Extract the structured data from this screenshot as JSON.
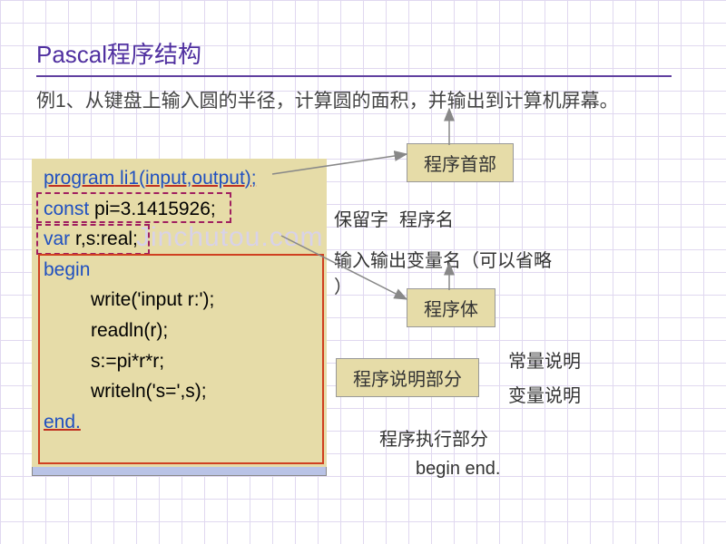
{
  "title": "Pascal程序结构",
  "example": "例1、从键盘上输入圆的半径，计算圆的面积，并输出到计算机屏幕。",
  "code": {
    "l1a": "program",
    "l1b": " li1(input,output);",
    "l2a": "const",
    "l2b": " pi=3.1415926;",
    "l3a": "var",
    "l3b": " r,s:real;",
    "l4": "begin",
    "l5": "write('input r:');",
    "l6": "readln(r);",
    "l7": "s:=pi*r*r;",
    "l8": "writeln('s=',s);",
    "l9": "end."
  },
  "labels": {
    "header": "程序首部",
    "body": "程序体",
    "desc": "程序说明部分",
    "keep": "保留字",
    "name": "程序名",
    "io": "输入输出变量名（可以省略",
    "paren": "）",
    "const": "常量说明",
    "var": "变量说明",
    "exec": "程序执行部分",
    "beginend": "begin  end."
  },
  "watermark": "Jinchutou.com"
}
